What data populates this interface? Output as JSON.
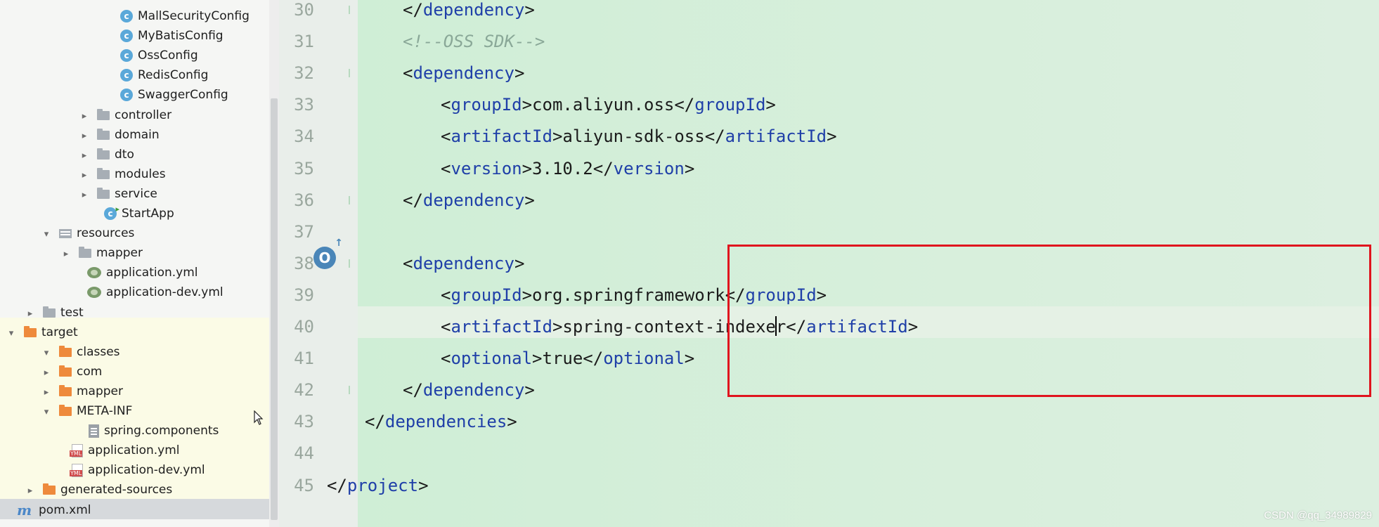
{
  "tree": {
    "rows": [
      {
        "label": "MallSecurityConfig",
        "kind": "class"
      },
      {
        "label": "MyBatisConfig",
        "kind": "class"
      },
      {
        "label": "OssConfig",
        "kind": "class"
      },
      {
        "label": "RedisConfig",
        "kind": "class"
      },
      {
        "label": "SwaggerConfig",
        "kind": "class"
      },
      {
        "label": "controller",
        "kind": "folder"
      },
      {
        "label": "domain",
        "kind": "folder"
      },
      {
        "label": "dto",
        "kind": "folder"
      },
      {
        "label": "modules",
        "kind": "folder"
      },
      {
        "label": "service",
        "kind": "folder"
      },
      {
        "label": "StartApp",
        "kind": "class-start"
      },
      {
        "label": "resources",
        "kind": "resources"
      },
      {
        "label": "mapper",
        "kind": "folder"
      },
      {
        "label": "application.yml",
        "kind": "yml"
      },
      {
        "label": "application-dev.yml",
        "kind": "yml"
      },
      {
        "label": "test",
        "kind": "folder"
      },
      {
        "label": "target",
        "kind": "folder-orange"
      },
      {
        "label": "classes",
        "kind": "folder-orange"
      },
      {
        "label": "com",
        "kind": "folder-orange"
      },
      {
        "label": "mapper",
        "kind": "folder-orange"
      },
      {
        "label": "META-INF",
        "kind": "folder-orange"
      },
      {
        "label": "spring.components",
        "kind": "file"
      },
      {
        "label": "application.yml",
        "kind": "ymlfile"
      },
      {
        "label": "application-dev.yml",
        "kind": "ymlfile"
      },
      {
        "label": "generated-sources",
        "kind": "folder-orange"
      },
      {
        "label": "pom.xml",
        "kind": "maven"
      }
    ]
  },
  "editor": {
    "lines": [
      {
        "num": "30",
        "indent": 2,
        "tokens": [
          {
            "t": "</",
            "c": "p"
          },
          {
            "t": "dependency",
            "c": "tag"
          },
          {
            "t": ">",
            "c": "p"
          }
        ]
      },
      {
        "num": "31",
        "indent": 2,
        "tokens": [
          {
            "t": "<!--OSS SDK-->",
            "c": "comment"
          }
        ]
      },
      {
        "num": "32",
        "indent": 2,
        "tokens": [
          {
            "t": "<",
            "c": "p"
          },
          {
            "t": "dependency",
            "c": "tag"
          },
          {
            "t": ">",
            "c": "p"
          }
        ]
      },
      {
        "num": "33",
        "indent": 3,
        "tokens": [
          {
            "t": "<",
            "c": "p"
          },
          {
            "t": "groupId",
            "c": "tag"
          },
          {
            "t": ">com.aliyun.oss</",
            "c": "p"
          },
          {
            "t": "groupId",
            "c": "tag"
          },
          {
            "t": ">",
            "c": "p"
          }
        ]
      },
      {
        "num": "34",
        "indent": 3,
        "tokens": [
          {
            "t": "<",
            "c": "p"
          },
          {
            "t": "artifactId",
            "c": "tag"
          },
          {
            "t": ">aliyun-sdk-oss</",
            "c": "p"
          },
          {
            "t": "artifactId",
            "c": "tag"
          },
          {
            "t": ">",
            "c": "p"
          }
        ]
      },
      {
        "num": "35",
        "indent": 3,
        "tokens": [
          {
            "t": "<",
            "c": "p"
          },
          {
            "t": "version",
            "c": "tag"
          },
          {
            "t": ">3.10.2</",
            "c": "p"
          },
          {
            "t": "version",
            "c": "tag"
          },
          {
            "t": ">",
            "c": "p"
          }
        ]
      },
      {
        "num": "36",
        "indent": 2,
        "tokens": [
          {
            "t": "</",
            "c": "p"
          },
          {
            "t": "dependency",
            "c": "tag"
          },
          {
            "t": ">",
            "c": "p"
          }
        ]
      },
      {
        "num": "37",
        "indent": 0,
        "tokens": []
      },
      {
        "num": "38",
        "indent": 2,
        "tokens": [
          {
            "t": "<",
            "c": "p"
          },
          {
            "t": "dependency",
            "c": "tag"
          },
          {
            "t": ">",
            "c": "p"
          }
        ]
      },
      {
        "num": "39",
        "indent": 3,
        "tokens": [
          {
            "t": "<",
            "c": "p"
          },
          {
            "t": "groupId",
            "c": "tag"
          },
          {
            "t": ">org.springframework</",
            "c": "p"
          },
          {
            "t": "groupId",
            "c": "tag"
          },
          {
            "t": ">",
            "c": "p"
          }
        ]
      },
      {
        "num": "40",
        "indent": 3,
        "tokens": [
          {
            "t": "<",
            "c": "p"
          },
          {
            "t": "artifactId",
            "c": "tag"
          },
          {
            "t": ">spring-context-indexe",
            "c": "p"
          },
          {
            "t": "|",
            "c": "caret"
          },
          {
            "t": "r</",
            "c": "p"
          },
          {
            "t": "artifactId",
            "c": "tag"
          },
          {
            "t": ">",
            "c": "p"
          }
        ]
      },
      {
        "num": "41",
        "indent": 3,
        "tokens": [
          {
            "t": "<",
            "c": "p"
          },
          {
            "t": "optional",
            "c": "tag"
          },
          {
            "t": ">true</",
            "c": "p"
          },
          {
            "t": "optional",
            "c": "tag"
          },
          {
            "t": ">",
            "c": "p"
          }
        ]
      },
      {
        "num": "42",
        "indent": 2,
        "tokens": [
          {
            "t": "</",
            "c": "p"
          },
          {
            "t": "dependency",
            "c": "tag"
          },
          {
            "t": ">",
            "c": "p"
          }
        ]
      },
      {
        "num": "43",
        "indent": 1,
        "tokens": [
          {
            "t": "</",
            "c": "p"
          },
          {
            "t": "dependencies",
            "c": "tag"
          },
          {
            "t": ">",
            "c": "p"
          }
        ]
      },
      {
        "num": "44",
        "indent": 0,
        "tokens": []
      },
      {
        "num": "45",
        "indent": 0,
        "tokens": [
          {
            "t": "</",
            "c": "p"
          },
          {
            "t": "project",
            "c": "tag"
          },
          {
            "t": ">",
            "c": "p"
          }
        ]
      }
    ],
    "gutter_badge": "O"
  },
  "watermark": "CSDN @qq_34989829",
  "colors": {
    "highlight_box": "#e0141e",
    "xml_tag": "#1f3fa8",
    "comment": "#8aa898",
    "target_folder": "#ee8a3c"
  }
}
